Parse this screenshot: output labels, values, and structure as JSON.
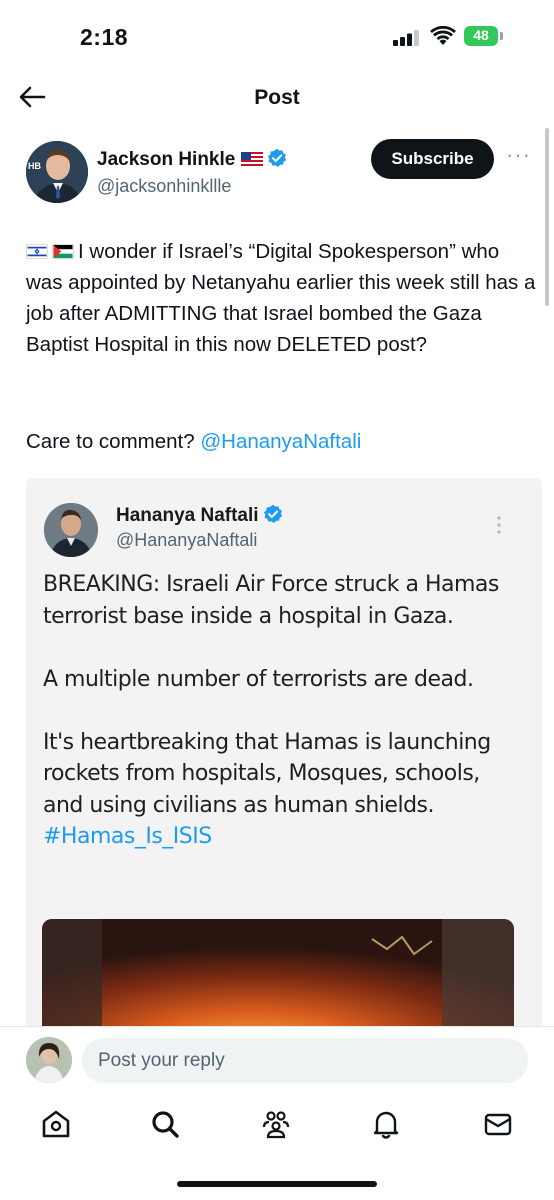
{
  "status_bar": {
    "time": "2:18",
    "battery": "48"
  },
  "header": {
    "title": "Post"
  },
  "author": {
    "name": "Jackson Hinkle",
    "handle": "@jacksonhinkllle",
    "avatar_badge": "HB"
  },
  "subscribe": {
    "label": "Subscribe"
  },
  "more": {
    "label": "···"
  },
  "post": {
    "text": "I wonder if Israel’s “Digital Spokesperson” who was appointed by Netanyahu earlier this week still has a job after ADMITTING that Israel bombed the Gaza Baptist Hospital in this now DELETED post?",
    "comment_prefix": "Care to comment? ",
    "mention": "@HananyaNaftali"
  },
  "quoted": {
    "name": "Hananya Naftali",
    "handle": "@HananyaNaftali",
    "paragraph1": "BREAKING: Israeli Air Force struck a Hamas terrorist base inside a hospital in Gaza.",
    "paragraph2": "A multiple number of terrorists are dead.",
    "paragraph3": "It's heartbreaking that Hamas is launching rockets from hospitals, Mosques, schools, and using civilians as human shields.",
    "hashtag": "#Hamas_Is_ISIS"
  },
  "reply": {
    "placeholder": "Post your reply"
  },
  "nav": {
    "items": [
      "home-icon",
      "search-icon",
      "communities-icon",
      "notifications-icon",
      "messages-icon"
    ]
  },
  "colors": {
    "accent": "#1d9bf0",
    "text": "#0f1419",
    "secondary": "#536471",
    "battery": "#34c759"
  }
}
